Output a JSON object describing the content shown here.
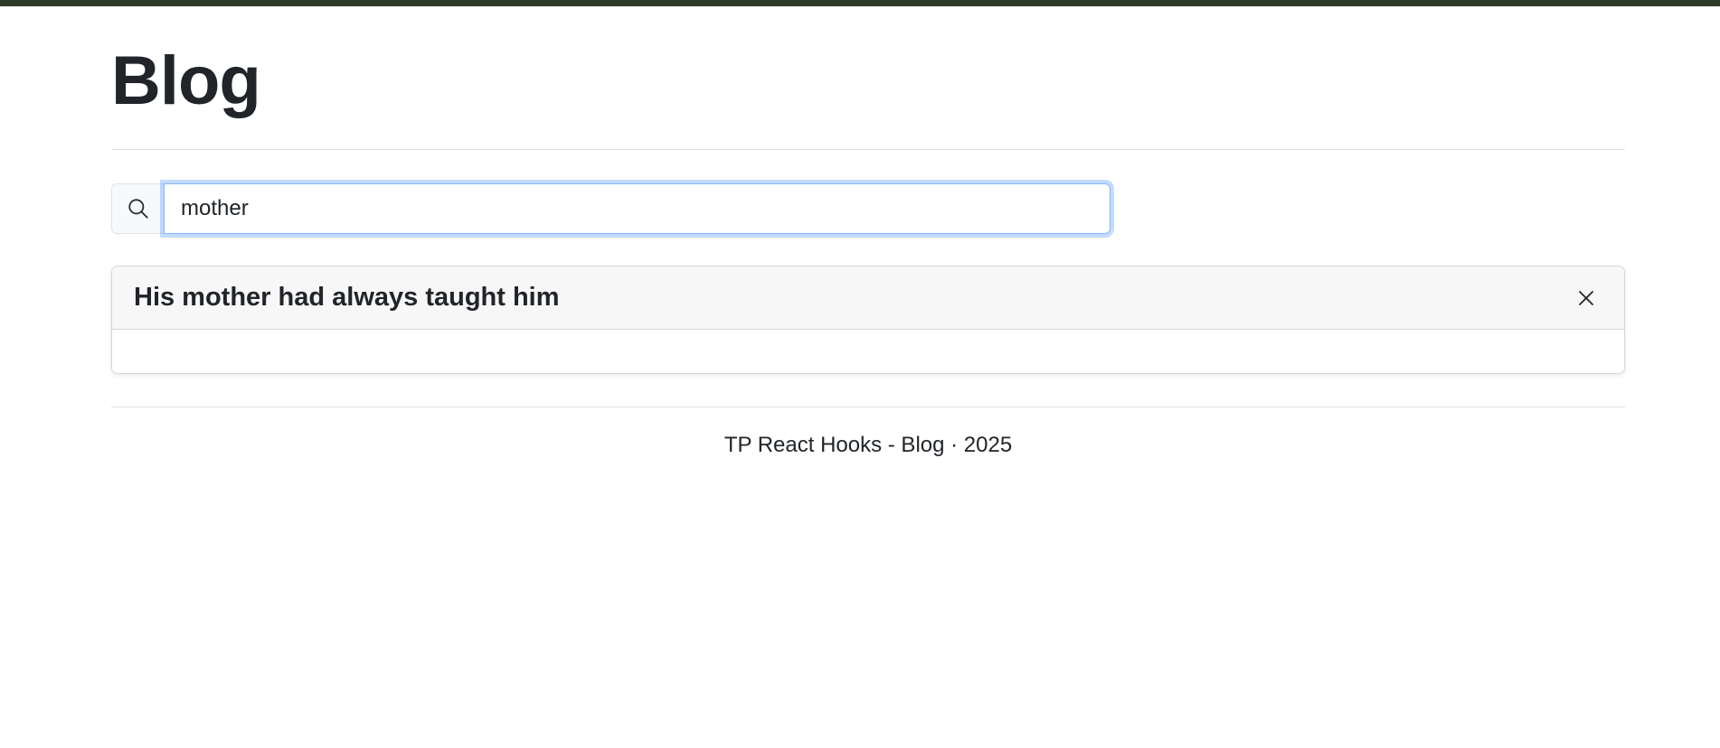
{
  "header": {
    "title": "Blog"
  },
  "search": {
    "value": "mother",
    "icon": "search-icon"
  },
  "posts": [
    {
      "title": "His mother had always taught him",
      "body": "",
      "close_icon": "close-icon"
    }
  ],
  "footer": {
    "text": "TP React Hooks - Blog · 2025"
  },
  "colors": {
    "top_bar": "#2d3a2a",
    "focus_ring": "#86b7fe"
  }
}
